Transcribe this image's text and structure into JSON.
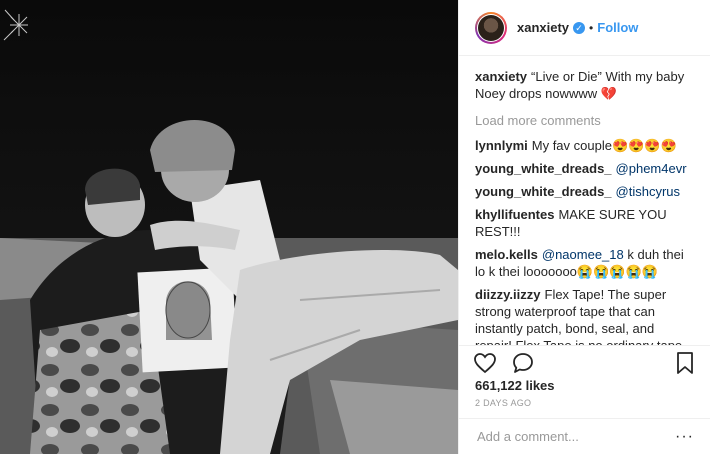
{
  "post": {
    "username": "xanxiety",
    "verified": true,
    "separator": "•",
    "follow_label": "Follow",
    "caption_user": "xanxiety",
    "caption_text": "“Live or Die” With my baby Noey drops nowwww 💔",
    "load_more": "Load more comments",
    "likes": "661,122 likes",
    "timestamp": "2 DAYS AGO",
    "add_comment_placeholder": "Add a comment...",
    "more_label": "···"
  },
  "comments": [
    {
      "user": "lynnlymi",
      "text": "My fav couple😍😍😍😍"
    },
    {
      "user": "young_white_dreads_",
      "mention": "@phem4evr",
      "text": ""
    },
    {
      "user": "young_white_dreads_",
      "mention": "@tishcyrus",
      "text": ""
    },
    {
      "user": "khyllifuentes",
      "text": "MAKE SURE YOU REST!!!"
    },
    {
      "user": "melo.kells",
      "mention": "@naomee_18",
      "text": "k duh thei lo k thei looooooo😭😭😭😭😭"
    },
    {
      "user": "diizzy.iizzy",
      "text": "Flex Tape! The super strong waterproof tape that can instantly patch, bond, seal, and repair! Flex Tape is no ordinary tape. It's triple thick adhesive virtually welds itself to surfaces, instantly stopping the toughest leaks. Leaky pipes can cause MAJOR damage, but flex tape grips on tight and bonds instantly. PLUS, Flex Tape's powerful adhesive is so strong,"
    }
  ],
  "icons": {
    "heart": "heart-icon",
    "comment": "comment-icon",
    "bookmark": "bookmark-icon",
    "verified": "verified-badge-icon"
  },
  "colors": {
    "link": "#3897f0",
    "mention": "#003569",
    "muted": "#999999",
    "text": "#262626"
  }
}
